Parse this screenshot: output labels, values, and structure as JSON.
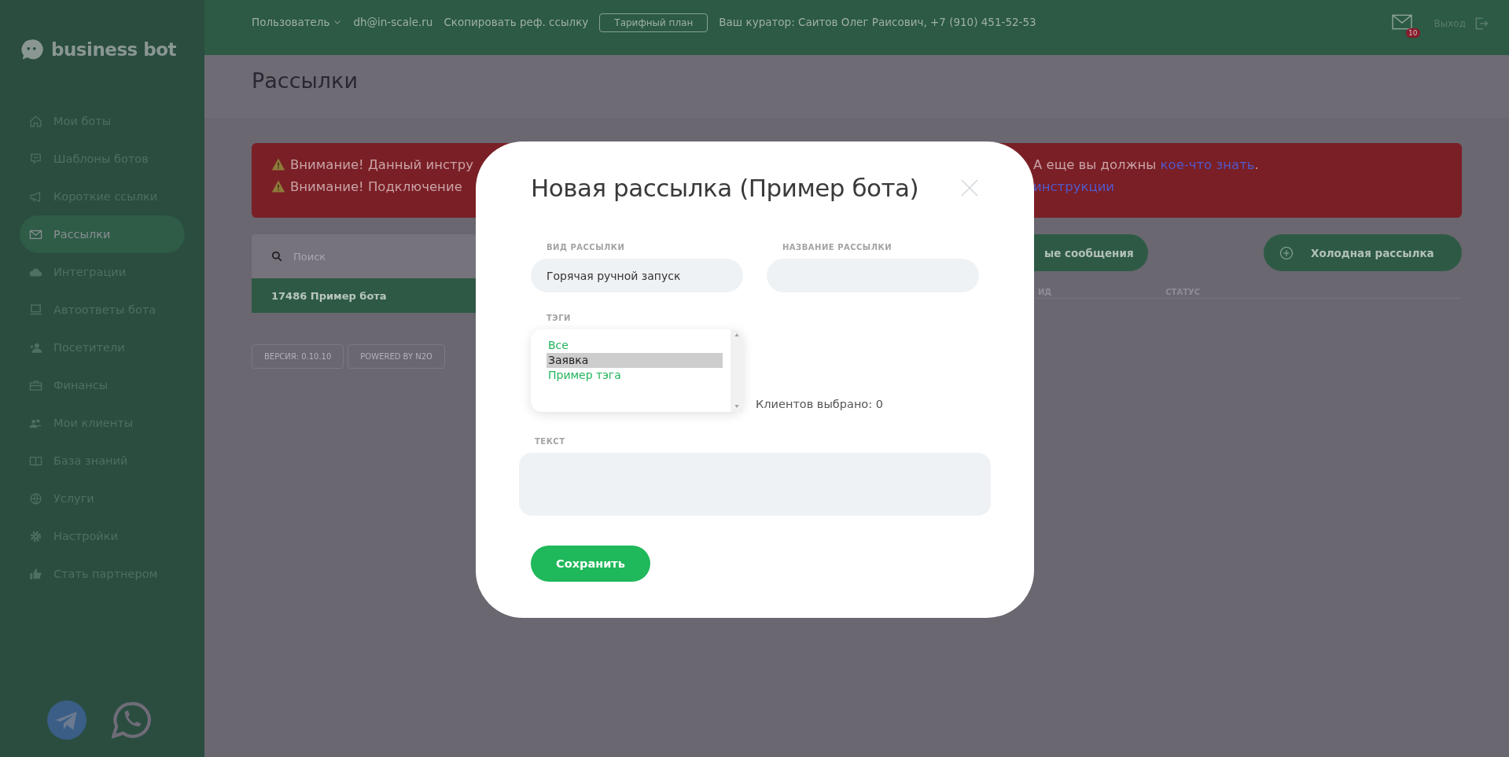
{
  "sidebar": {
    "logo": "business bot",
    "items": [
      {
        "label": "Мои боты",
        "selected": false
      },
      {
        "label": "Шаблоны ботов",
        "selected": false
      },
      {
        "label": "Короткие ссылки",
        "selected": false
      },
      {
        "label": "Рассылки",
        "selected": true
      },
      {
        "label": "Интеграции",
        "selected": false
      },
      {
        "label": "Автоответы бота",
        "selected": false
      },
      {
        "label": "Посетители",
        "selected": false
      },
      {
        "label": "Финансы",
        "selected": false
      },
      {
        "label": "Мои клиенты",
        "selected": false
      },
      {
        "label": "База знаний",
        "selected": false
      },
      {
        "label": "Услуги",
        "selected": false
      },
      {
        "label": "Настройки",
        "selected": false
      },
      {
        "label": "Стать партнером",
        "selected": false
      }
    ]
  },
  "topbar": {
    "user_menu": "Пользователь",
    "email": "dh@in-scale.ru",
    "ref_link": "Скопировать реф. ссылку",
    "plan_button": "Тарифный план",
    "curator": "Ваш куратор: Саитов Олег Раисович, +7 (910) 451-52-53",
    "mail_badge": "10",
    "logout": "Выход"
  },
  "page": {
    "title": "Рассылки",
    "alerts": [
      {
        "left": "Внимание! Данный инстру",
        "right": "А еще вы должны ",
        "link": "кое-что знать",
        "after": "."
      },
      {
        "left": "Внимание! Подключение",
        "link": "инструкции"
      }
    ],
    "search": {
      "placeholder": "Поиск"
    },
    "bots": [
      {
        "label": "17486 Пример бота",
        "selected": true
      }
    ],
    "buttons": [
      {
        "label": "ые сообщения",
        "kind": "plain"
      },
      {
        "label": "Холодная рассылка",
        "kind": "add"
      }
    ],
    "table": {
      "columns": [
        "ИД",
        "СТАТУС"
      ]
    },
    "footer": [
      "ВЕРСИЯ: 0.10.10",
      "POWERED BY N2O"
    ]
  },
  "modal": {
    "title": "Новая рассылка (Пример бота)",
    "type_label": "ВИД РАССЫЛКИ",
    "type_value": "Горячая ручной запуск",
    "name_label": "НАЗВАНИЕ РАССЫЛКИ",
    "tags_label": "ТЭГИ",
    "tags": [
      {
        "label": "Все",
        "selected": false
      },
      {
        "label": "Заявка",
        "selected": true
      },
      {
        "label": "Пример тэга",
        "selected": false
      }
    ],
    "clients_selected": "Клиентов выбрано: 0",
    "text_label": "ТЕКСТ",
    "save_button": "Сохранить"
  }
}
